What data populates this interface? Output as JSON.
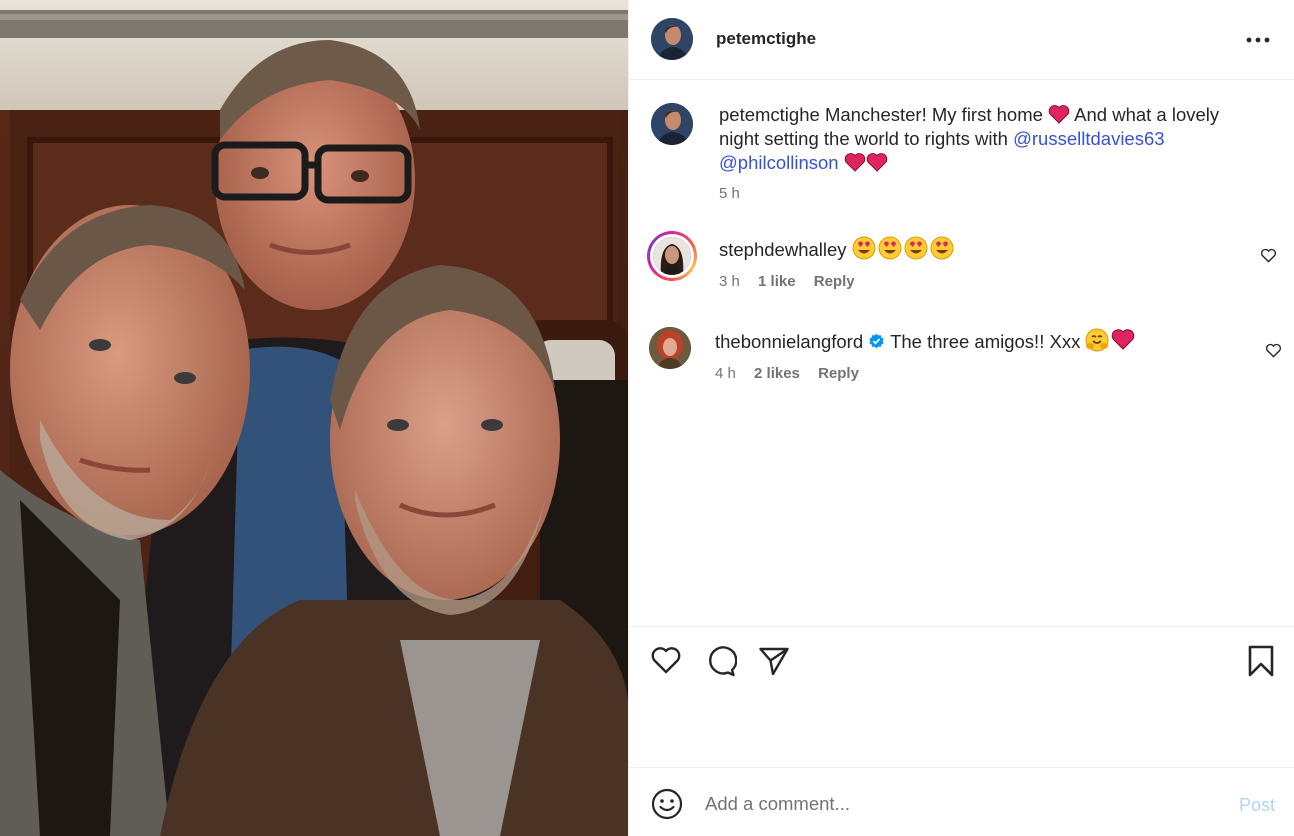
{
  "post": {
    "author": "petemctighe",
    "more_icon": "more-horizontal-icon"
  },
  "caption": {
    "username": "petemctighe",
    "text_1": "Manchester! My first home",
    "text_2": "And what a lovely night setting the world to rights with",
    "mention_1": "@russelltdavies63",
    "mention_2": "@philcollinson",
    "time": "5 h"
  },
  "comments": [
    {
      "username": "stephdewhalley",
      "emojis": "heart-eyes x4",
      "time": "3 h",
      "likes": "1 like",
      "reply": "Reply"
    },
    {
      "username": "thebonnielangford",
      "verified": true,
      "text": "The three amigos!! Xxx",
      "time": "4 h",
      "likes": "2 likes",
      "reply": "Reply"
    }
  ],
  "actions": {
    "like_icon": "heart-outline-icon",
    "comment_icon": "comment-bubble-icon",
    "share_icon": "paper-plane-icon",
    "save_icon": "bookmark-icon"
  },
  "composer": {
    "placeholder": "Add a comment...",
    "post_label": "Post"
  },
  "colors": {
    "link": "#3653d3",
    "muted": "#737373",
    "post_disabled": "#b3d3f7",
    "heart": "#e0245e"
  }
}
